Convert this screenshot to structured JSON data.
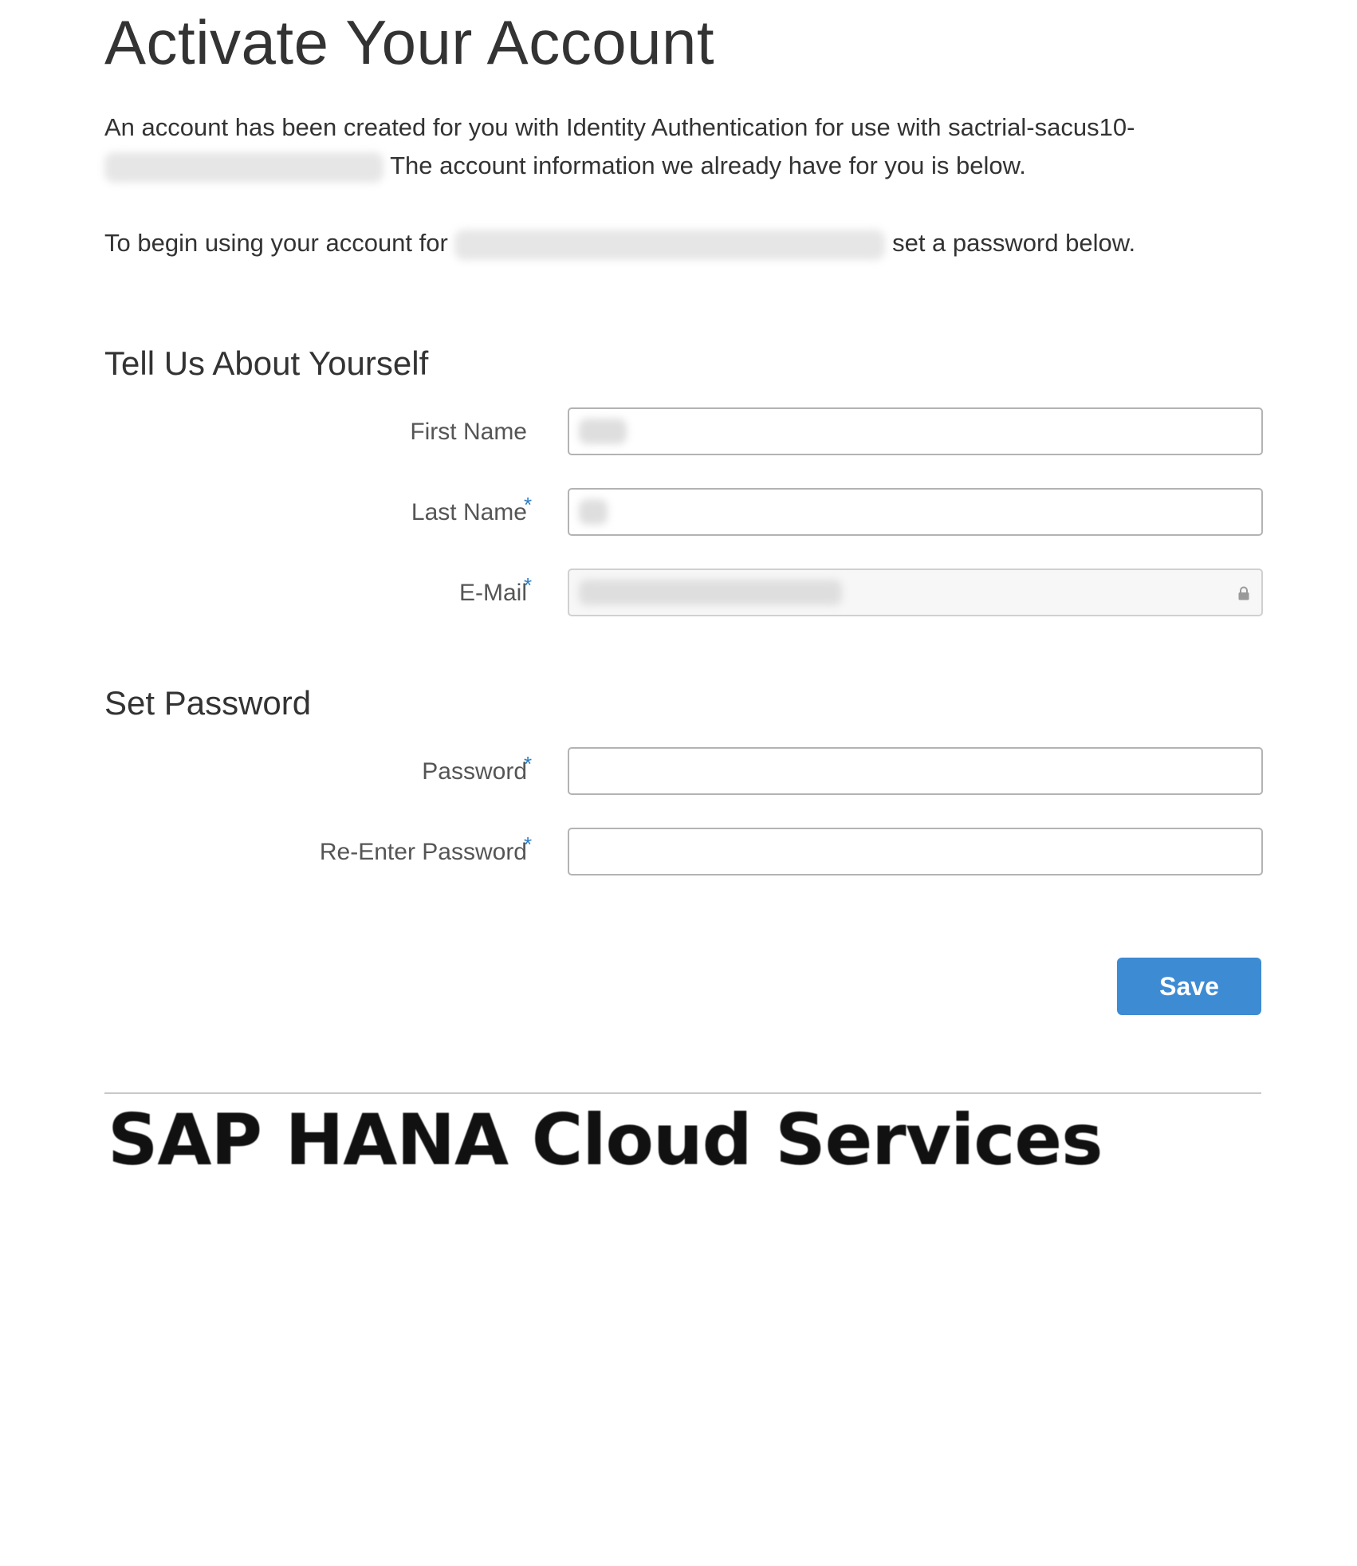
{
  "page": {
    "title": "Activate Your Account"
  },
  "intro": {
    "line1_prefix": "An account has been created for you with Identity Authentication for use with sactrial-sacus10-",
    "line1_suffix": "The account information we already have for you is below.",
    "line2_prefix": "To begin using your account for",
    "line2_suffix": "set a password below."
  },
  "about_section": {
    "title": "Tell Us About Yourself",
    "fields": [
      {
        "label": "First Name",
        "required": false,
        "value": "",
        "readonly": false
      },
      {
        "label": "Last Name",
        "required": true,
        "value": "",
        "readonly": false
      },
      {
        "label": "E-Mail",
        "required": true,
        "value": "",
        "readonly": true
      }
    ]
  },
  "password_section": {
    "title": "Set Password",
    "fields": [
      {
        "label": "Password",
        "required": true,
        "value": ""
      },
      {
        "label": "Re-Enter Password",
        "required": true,
        "value": ""
      }
    ]
  },
  "required_marker": "*",
  "actions": {
    "save_label": "Save"
  },
  "footer": {
    "brand": "SAP HANA Cloud Services"
  },
  "icons": {
    "readonly_field": "lock-icon"
  },
  "colors": {
    "accent": "#3d8bd3",
    "required_star": "#2b7cc4",
    "text": "#333333"
  }
}
